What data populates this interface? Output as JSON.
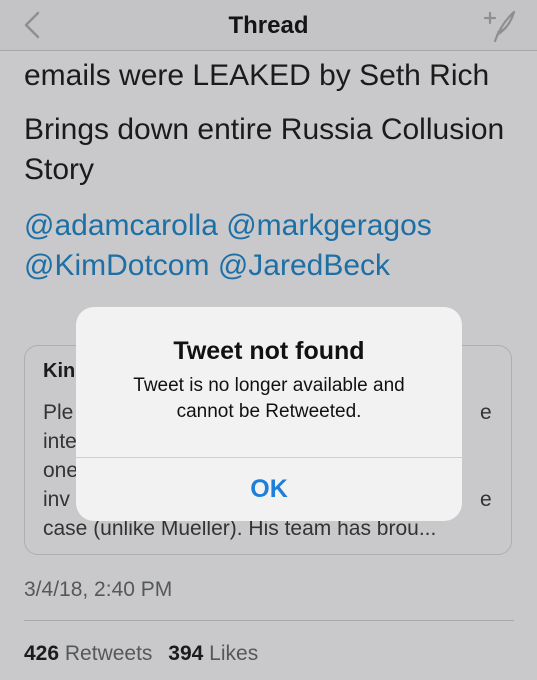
{
  "header": {
    "title": "Thread",
    "back_icon": "chevron-left-icon",
    "compose_icon": "compose-tweet-icon"
  },
  "tweet": {
    "line1": "emails were LEAKED by Seth Rich",
    "line2": "Brings down entire Russia Collusion",
    "line3": "Story",
    "mentions_line1": [
      "@adamcarolla",
      "@markgeragos"
    ],
    "mentions_line2": [
      "@KimDotcom",
      "@JaredBeck"
    ],
    "timestamp": "3/4/18, 2:40 PM",
    "retweets_count": "426",
    "retweets_label": "Retweets",
    "likes_count": "394",
    "likes_label": "Likes"
  },
  "quoted_card": {
    "author_fragment": "Kin",
    "left_fragments": [
      "Ple",
      "inte",
      "one",
      "inv"
    ],
    "right_fragments": [
      "e",
      "e"
    ],
    "last_line": "case (unlike Mueller). His team has brou..."
  },
  "alert": {
    "title": "Tweet not found",
    "message_line1": "Tweet is no longer available and",
    "message_line2": "cannot be Retweeted.",
    "ok_label": "OK"
  },
  "colors": {
    "link": "#1d6fa5",
    "alert_button": "#1f7fd8",
    "dimmed_background": "#c9c9cb"
  }
}
